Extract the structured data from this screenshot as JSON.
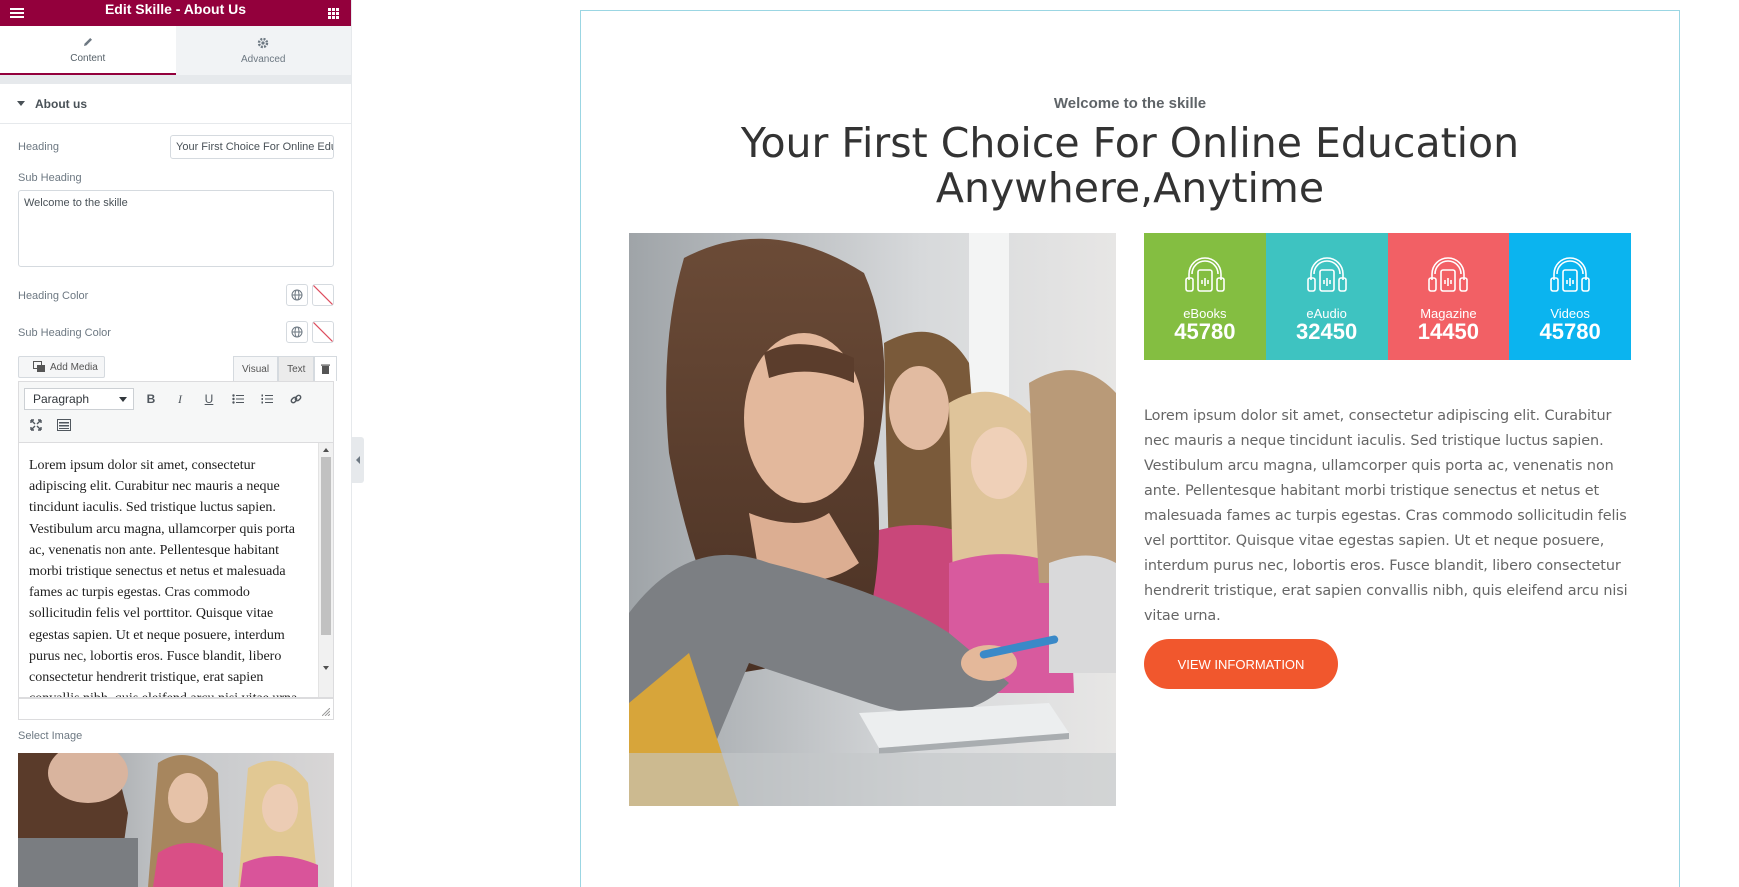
{
  "panel": {
    "title": "Edit Skille - About Us",
    "tabs": [
      {
        "label": "Content",
        "icon": "pencil-icon"
      },
      {
        "label": "Advanced",
        "icon": "gear-icon"
      }
    ],
    "section_title": "About us",
    "heading_label": "Heading",
    "heading_value": "Your First Choice For Online Education Anywhere,Anytime",
    "subheading_label": "Sub Heading",
    "subheading_value": "Welcome to the skille",
    "heading_color_label": "Heading Color",
    "subheading_color_label": "Sub Heading Color",
    "add_media_label": "Add Media",
    "editor_tabs": [
      "Visual",
      "Text"
    ],
    "paragraph_select": "Paragraph",
    "toolbar_buttons": [
      "B",
      "I",
      "U"
    ],
    "editor_text": "Lorem ipsum dolor sit amet, consectetur adipiscing elit. Curabitur nec mauris a neque tincidunt iaculis. Sed tristique luctus sapien. Vestibulum arcu magna, ullamcorper quis porta ac, venenatis non ante. Pellentesque habitant morbi tristique senectus et netus et malesuada fames ac turpis egestas. Cras commodo sollicitudin felis vel porttitor. Quisque vitae egestas sapien. Ut et neque posuere, interdum purus nec, lobortis eros. Fusce blandit, libero consectetur hendrerit tristique, erat sapien convallis nibh, quis eleifend arcu nisi vitae urna.",
    "select_image_label": "Select Image",
    "accent_color": "#93003c"
  },
  "preview": {
    "sub_heading": "Welcome to the skille",
    "heading": "Your First Choice For Online Education Anywhere,Anytime",
    "stats": [
      {
        "label": "eBooks",
        "value": "45780",
        "color": "#84be41",
        "icon": "headphones-icon"
      },
      {
        "label": "eAudio",
        "value": "32450",
        "color": "#3ec3c1",
        "icon": "headphones-icon"
      },
      {
        "label": "Magazine",
        "value": "14450",
        "color": "#f26065",
        "icon": "headphones-icon"
      },
      {
        "label": "Videos",
        "value": "45780",
        "color": "#0bb4ef",
        "icon": "headphones-icon"
      }
    ],
    "paragraph": "Lorem ipsum dolor sit amet, consectetur adipiscing elit. Curabitur nec mauris a neque tincidunt iaculis. Sed tristique luctus sapien. Vestibulum arcu magna, ullamcorper quis porta ac, venenatis non ante. Pellentesque habitant morbi tristique senectus et netus et malesuada fames ac turpis egestas. Cras commodo sollicitudin felis vel porttitor. Quisque vitae egestas sapien. Ut et neque posuere, interdum purus nec, lobortis eros. Fusce blandit, libero consectetur hendrerit tristique, erat sapien convallis nibh, quis eleifend arcu nisi vitae urna.",
    "button_label": "VIEW INFORMATION",
    "button_color": "#f1572d"
  }
}
